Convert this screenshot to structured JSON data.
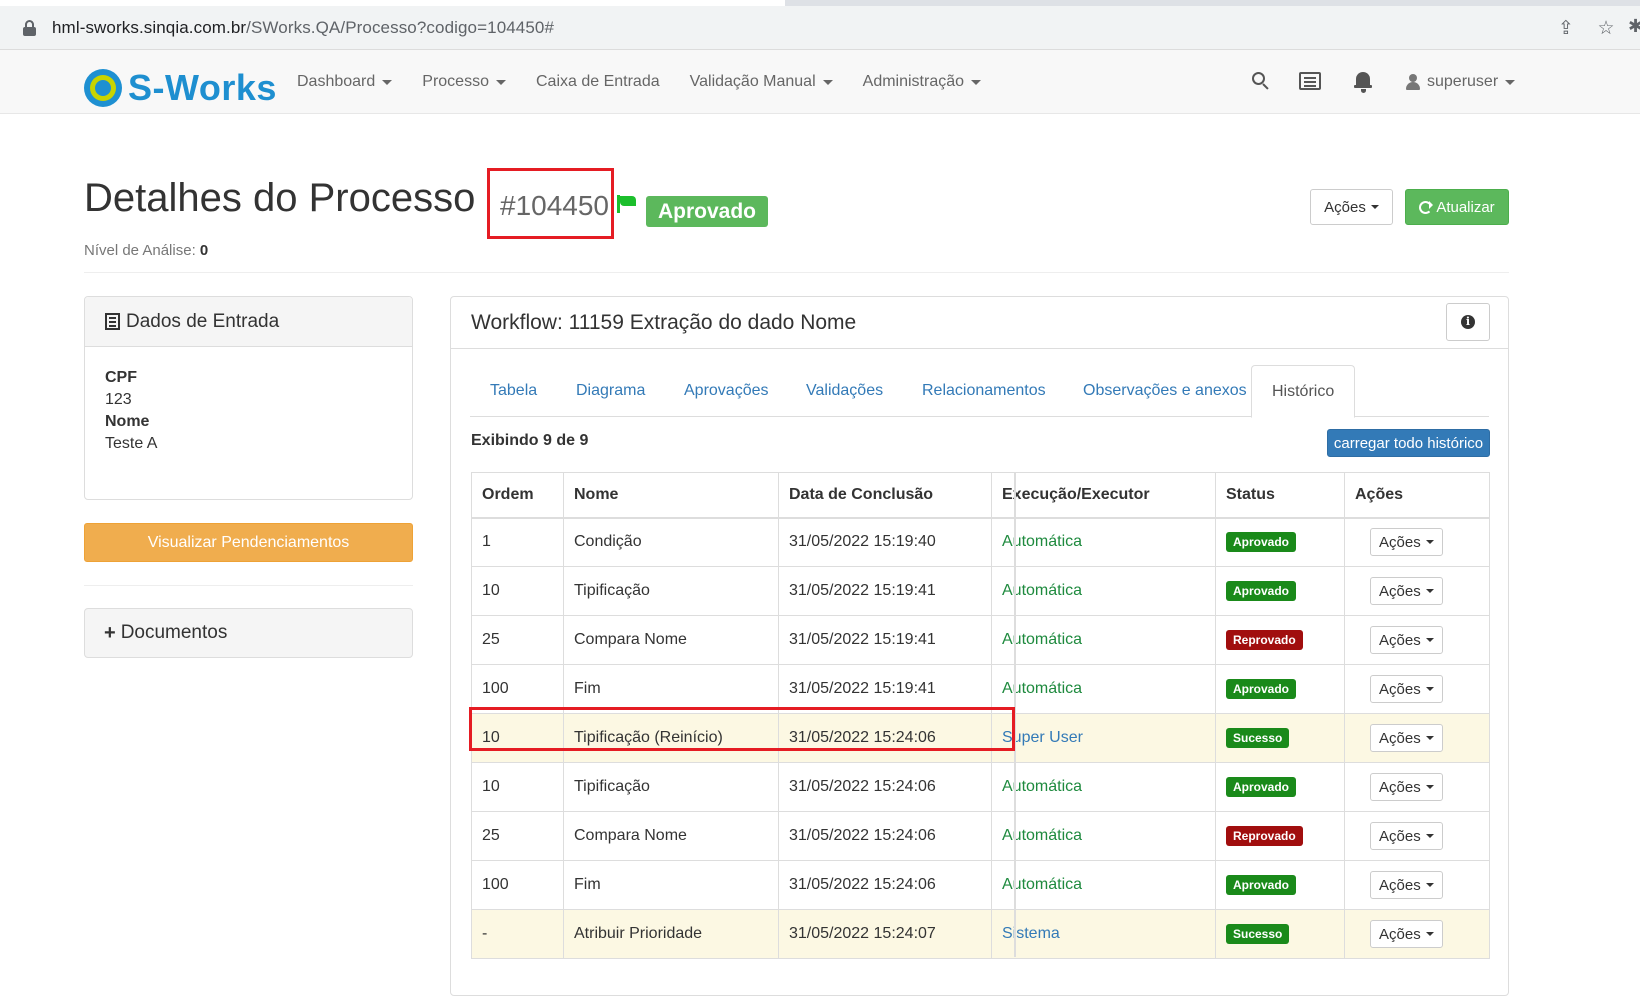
{
  "browser": {
    "url_host": "hml-sworks.sinqia.com.br",
    "url_path": "/SWorks.QA/Processo?codigo=104450#"
  },
  "navbar": {
    "brand": "S-Works",
    "items": [
      "Dashboard",
      "Processo",
      "Caixa de Entrada",
      "Validação Manual",
      "Administração"
    ],
    "user": "superuser"
  },
  "header": {
    "title": "Detalhes do Processo",
    "process_id": "#104450",
    "status": "Aprovado",
    "nivel_label": "Nível de Análise:",
    "nivel_value": "0",
    "acoes_label": "Ações",
    "atualizar_label": "Atualizar"
  },
  "dados_entrada": {
    "title": "Dados de Entrada",
    "fields": [
      {
        "label": "CPF",
        "value": "123"
      },
      {
        "label": "Nome",
        "value": "Teste A"
      }
    ],
    "pend_button": "Visualizar Pendenciamentos",
    "documentos_label": "Documentos"
  },
  "workflow": {
    "title": "Workflow: 11159 Extração do dado Nome",
    "tabs": [
      "Tabela",
      "Diagrama",
      "Aprovações",
      "Validações",
      "Relacionamentos",
      "Observações e anexos",
      "Histórico"
    ],
    "active_tab": "Histórico",
    "exibindo": "Exibindo 9 de 9",
    "carregar_label": "carregar todo histórico",
    "columns": [
      "Ordem",
      "Nome",
      "Data de Conclusão",
      "Execução/Executor",
      "Status",
      "Ações"
    ],
    "rows": [
      {
        "ordem": "1",
        "nome": "Condição",
        "data": "31/05/2022 15:19:40",
        "exec": "Automática",
        "status": "Aprovado",
        "acoes": "Ações"
      },
      {
        "ordem": "10",
        "nome": "Tipificação",
        "data": "31/05/2022 15:19:41",
        "exec": "Automática",
        "status": "Aprovado",
        "acoes": "Ações"
      },
      {
        "ordem": "25",
        "nome": "Compara Nome",
        "data": "31/05/2022 15:19:41",
        "exec": "Automática",
        "status": "Reprovado",
        "acoes": "Ações"
      },
      {
        "ordem": "100",
        "nome": "Fim",
        "data": "31/05/2022 15:19:41",
        "exec": "Automática",
        "status": "Aprovado",
        "acoes": "Ações"
      },
      {
        "ordem": "10",
        "nome": "Tipificação (Reinício)",
        "data": "31/05/2022 15:24:06",
        "exec": "Super User",
        "status": "Sucesso",
        "acoes": "Ações"
      },
      {
        "ordem": "10",
        "nome": "Tipificação",
        "data": "31/05/2022 15:24:06",
        "exec": "Automática",
        "status": "Aprovado",
        "acoes": "Ações"
      },
      {
        "ordem": "25",
        "nome": "Compara Nome",
        "data": "31/05/2022 15:24:06",
        "exec": "Automática",
        "status": "Reprovado",
        "acoes": "Ações"
      },
      {
        "ordem": "100",
        "nome": "Fim",
        "data": "31/05/2022 15:24:06",
        "exec": "Automática",
        "status": "Aprovado",
        "acoes": "Ações"
      },
      {
        "ordem": "-",
        "nome": "Atribuir Prioridade",
        "data": "31/05/2022 15:24:07",
        "exec": "Sistema",
        "status": "Sucesso",
        "acoes": "Ações"
      }
    ]
  },
  "colors": {
    "brand_blue": "#1e8fd0",
    "success_green": "#5cb85c",
    "warning_orange": "#f0ad4e",
    "label_green": "#1a8a1a",
    "label_red": "#a10e0e",
    "highlight_red": "#e51c23"
  }
}
